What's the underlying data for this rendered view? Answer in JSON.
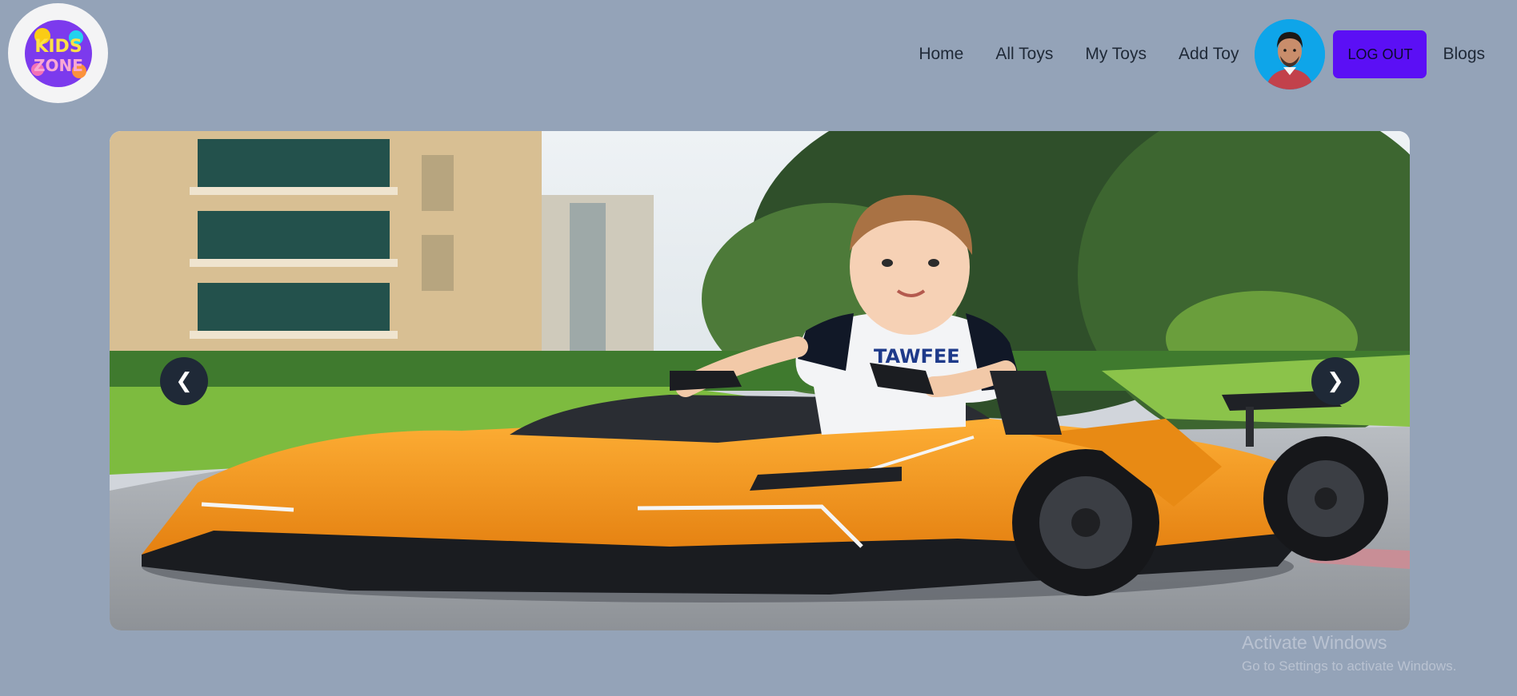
{
  "brand": {
    "logo_text_line1": "KIDS",
    "logo_text_line2": "ZONE"
  },
  "nav": {
    "items": [
      {
        "label": "Home"
      },
      {
        "label": "All Toys"
      },
      {
        "label": "My Toys"
      },
      {
        "label": "Add Toy"
      }
    ],
    "logout_label": "LOG OUT",
    "blogs_label": "Blogs"
  },
  "carousel": {
    "prev_label": "❮",
    "next_label": "❯",
    "shirt_text": "TAWFEE"
  },
  "watermark": {
    "title": "Activate Windows",
    "subtitle": "Go to Settings to activate Windows."
  },
  "colors": {
    "page_bg": "#94a3b8",
    "logout_bg": "#5b0ff5",
    "car_orange": "#f59a1b",
    "arrow_bg": "#1f2937"
  },
  "icons": {
    "logo": "kids-zone-logo",
    "avatar": "user-avatar",
    "prev": "chevron-left-icon",
    "next": "chevron-right-icon"
  }
}
